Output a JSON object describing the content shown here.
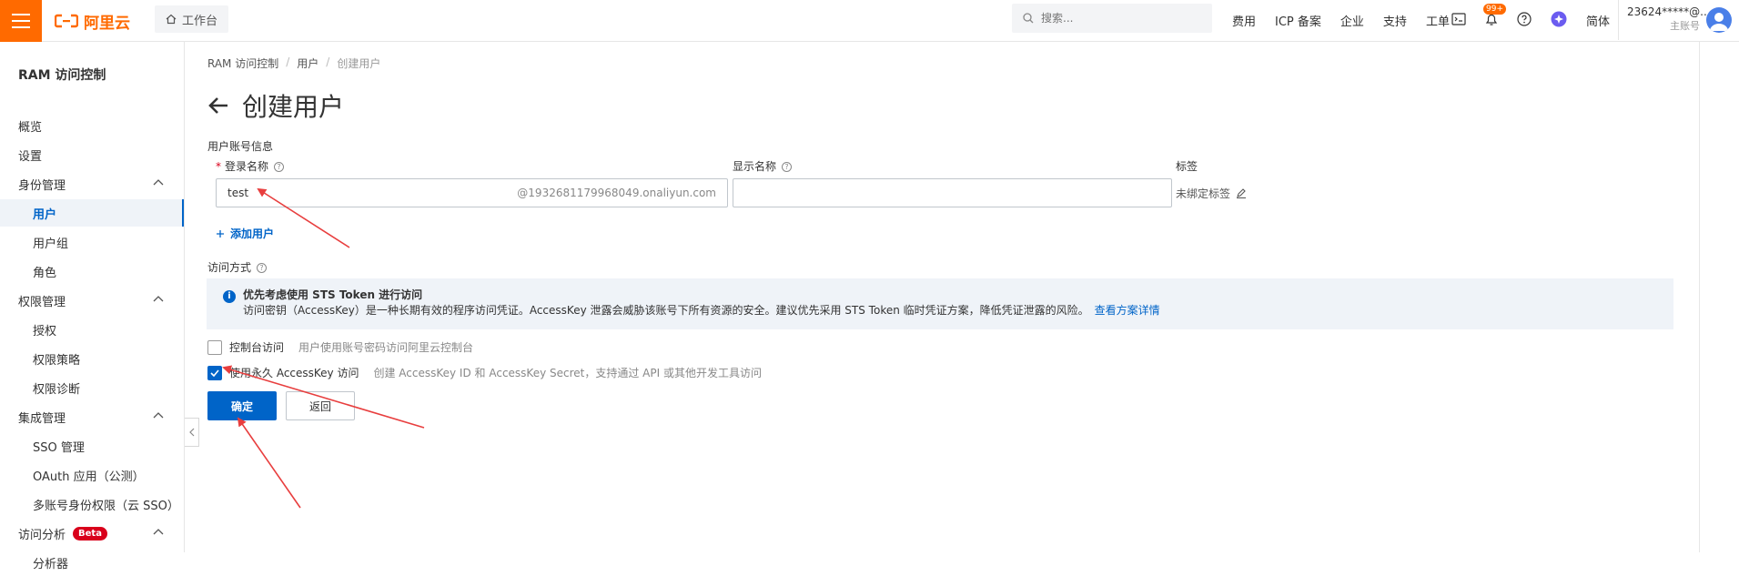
{
  "topbar": {
    "logo_text": "阿里云",
    "workbench_label": "工作台",
    "search_placeholder": "搜索...",
    "nav": [
      "费用",
      "ICP 备案",
      "企业",
      "支持",
      "工单"
    ],
    "notification_badge": "99+",
    "language": "简体",
    "account_name": "23624*****@...",
    "account_type": "主账号",
    "brand_color": "#ff6a00"
  },
  "sidebar": {
    "title": "RAM 访问控制",
    "items": [
      {
        "label": "概览",
        "level": 1
      },
      {
        "label": "设置",
        "level": 1
      },
      {
        "label": "身份管理",
        "level": 1,
        "group": true
      },
      {
        "label": "用户",
        "level": 2,
        "active": true
      },
      {
        "label": "用户组",
        "level": 2
      },
      {
        "label": "角色",
        "level": 2
      },
      {
        "label": "权限管理",
        "level": 1,
        "group": true
      },
      {
        "label": "授权",
        "level": 2
      },
      {
        "label": "权限策略",
        "level": 2
      },
      {
        "label": "权限诊断",
        "level": 2
      },
      {
        "label": "集成管理",
        "level": 1,
        "group": true
      },
      {
        "label": "SSO 管理",
        "level": 2
      },
      {
        "label": "OAuth 应用（公测）",
        "level": 2
      },
      {
        "label": "多账号身份权限（云 SSO）",
        "level": 2
      },
      {
        "label": "访问分析",
        "level": 1,
        "group": true,
        "badge": "Beta"
      },
      {
        "label": "分析器",
        "level": 2
      }
    ]
  },
  "breadcrumb": [
    "RAM 访问控制",
    "用户",
    "创建用户"
  ],
  "page_title": "创建用户",
  "form": {
    "section_label": "用户账号信息",
    "login_name_label": "登录名称",
    "login_name_value": "test",
    "login_name_suffix": "@1932681179968049.onaliyun.com",
    "display_name_label": "显示名称",
    "display_name_value": "",
    "tag_label": "标签",
    "tag_value": "未绑定标签",
    "add_user_label": "添加用户",
    "access_mode_label": "访问方式"
  },
  "alert": {
    "title": "优先考虑使用 STS Token 进行访问",
    "body": "访问密钥（AccessKey）是一种长期有效的程序访问凭证。AccessKey 泄露会威胁该账号下所有资源的安全。建议优先采用 STS Token 临时凭证方案，降低凭证泄露的风险。",
    "link": "查看方案详情"
  },
  "options": [
    {
      "label": "控制台访问",
      "desc": "用户使用账号密码访问阿里云控制台",
      "checked": false
    },
    {
      "label": "使用永久 AccessKey 访问",
      "desc": "创建 AccessKey ID 和 AccessKey Secret，支持通过 API 或其他开发工具访问",
      "checked": true
    }
  ],
  "buttons": {
    "confirm": "确定",
    "back": "返回"
  },
  "colors": {
    "primary": "#0064c8",
    "annotation_arrow": "#e83e3e"
  }
}
